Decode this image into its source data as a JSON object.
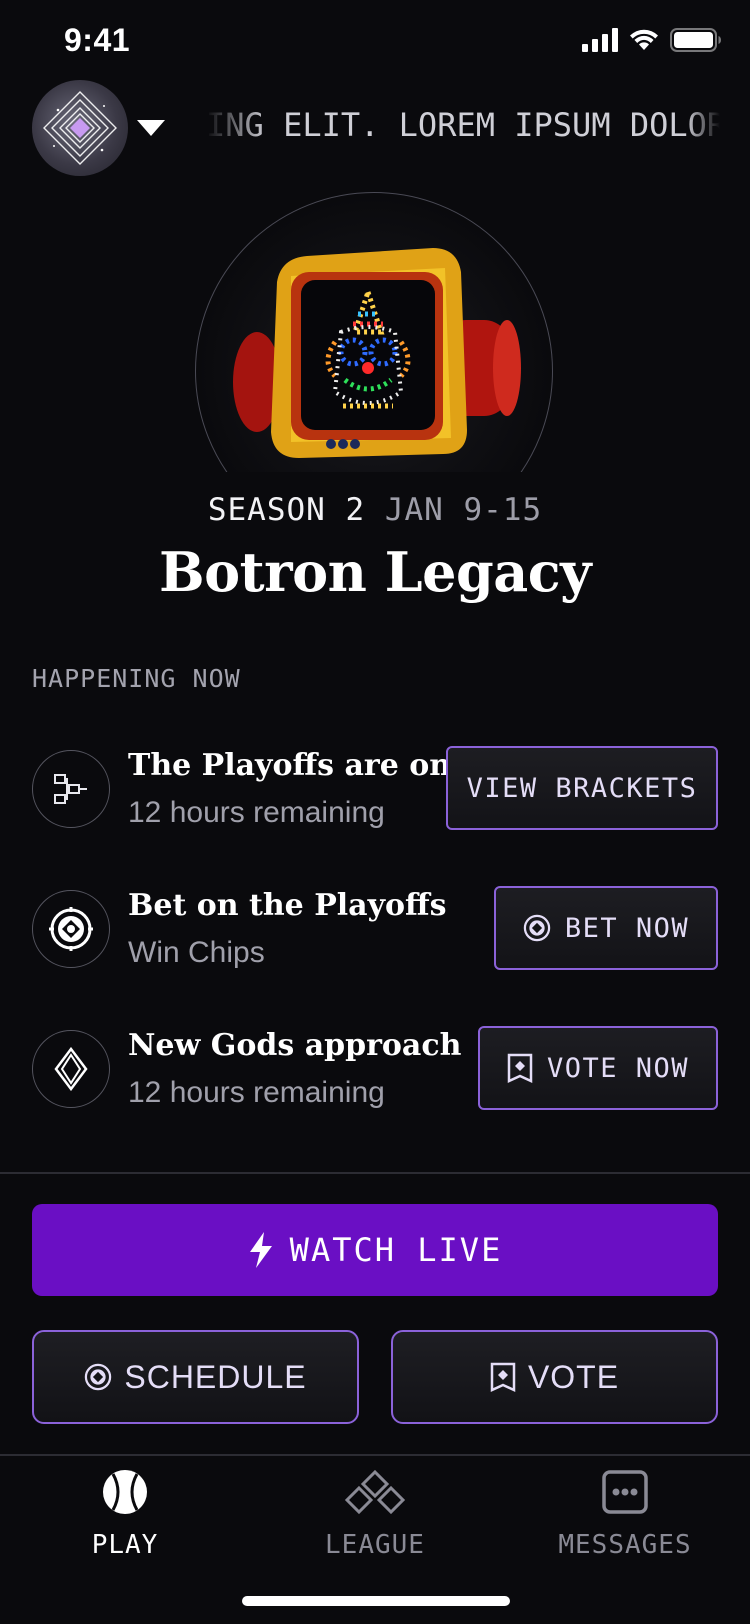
{
  "status_bar": {
    "time": "9:41"
  },
  "header": {
    "ticker_text": "ING ELIT. LOREM IPSUM DOLOR SIT AMET"
  },
  "season": {
    "label": "SEASON 2",
    "dates": "JAN 9-15",
    "title": "Botron Legacy"
  },
  "happening": {
    "label": "HAPPENING NOW",
    "items": [
      {
        "title": "The Playoffs are on",
        "subtitle": "12 hours remaining",
        "button": "VIEW BRACKETS",
        "icon": "bracket-icon",
        "button_icon": ""
      },
      {
        "title": "Bet on the Playoffs",
        "subtitle": "Win Chips",
        "button": "BET NOW",
        "icon": "chip-icon",
        "button_icon": "chip-icon"
      },
      {
        "title": "New Gods approach",
        "subtitle": "12 hours remaining",
        "button": "VOTE NOW",
        "icon": "diamond-icon",
        "button_icon": "ballot-icon"
      }
    ]
  },
  "actions": {
    "watch_live": "WATCH LIVE",
    "schedule": "SCHEDULE",
    "vote": "VOTE"
  },
  "tabs": [
    {
      "label": "PLAY",
      "icon": "ball-icon",
      "active": true
    },
    {
      "label": "LEAGUE",
      "icon": "league-icon",
      "active": false
    },
    {
      "label": "MESSAGES",
      "icon": "messages-icon",
      "active": false
    }
  ],
  "colors": {
    "background": "#0a0a0d",
    "accent": "#6a0fc4",
    "border_accent": "#8b62d9"
  }
}
